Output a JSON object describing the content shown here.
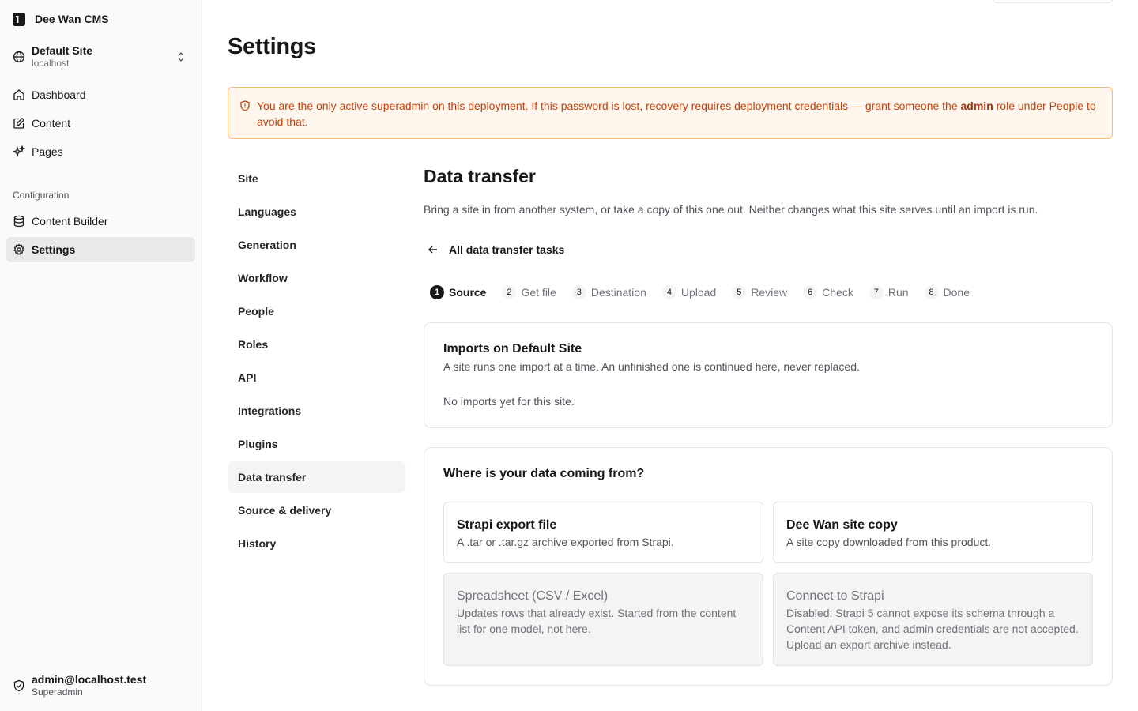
{
  "app": {
    "name": "Dee Wan CMS"
  },
  "site": {
    "name": "Default Site",
    "host": "localhost"
  },
  "nav": {
    "main": [
      {
        "label": "Dashboard",
        "icon": "home-icon"
      },
      {
        "label": "Content",
        "icon": "edit-icon"
      },
      {
        "label": "Pages",
        "icon": "sparkles-icon"
      }
    ],
    "group_label": "Configuration",
    "config": [
      {
        "label": "Content Builder",
        "icon": "database-icon"
      },
      {
        "label": "Settings",
        "icon": "gear-icon",
        "active": true
      }
    ]
  },
  "user": {
    "email": "admin@localhost.test",
    "role": "Superadmin"
  },
  "page": {
    "title": "Settings"
  },
  "alert": {
    "text_before": "You are the only active superadmin on this deployment. If this password is lost, recovery requires deployment credentials — grant someone the ",
    "strong": "admin",
    "text_after": " role under People to avoid that."
  },
  "settings_nav": [
    "Site",
    "Languages",
    "Generation",
    "Workflow",
    "People",
    "Roles",
    "API",
    "Integrations",
    "Plugins",
    "Data transfer",
    "Source & delivery",
    "History"
  ],
  "settings_nav_active": "Data transfer",
  "data_transfer": {
    "title": "Data transfer",
    "description": "Bring a site in from another system, or take a copy of this one out. Neither changes what this site serves until an import is run.",
    "back_label": "All data transfer tasks",
    "steps": [
      {
        "num": "1",
        "label": "Source",
        "current": true
      },
      {
        "num": "2",
        "label": "Get file"
      },
      {
        "num": "3",
        "label": "Destination"
      },
      {
        "num": "4",
        "label": "Upload"
      },
      {
        "num": "5",
        "label": "Review"
      },
      {
        "num": "6",
        "label": "Check"
      },
      {
        "num": "7",
        "label": "Run"
      },
      {
        "num": "8",
        "label": "Done"
      }
    ],
    "imports": {
      "title": "Imports on Default Site",
      "description": "A site runs one import at a time. An unfinished one is continued here, never replaced.",
      "empty": "No imports yet for this site."
    },
    "source": {
      "question": "Where is your data coming from?",
      "options": [
        {
          "title": "Strapi export file",
          "description": "A .tar or .tar.gz archive exported from Strapi.",
          "disabled": false
        },
        {
          "title": "Dee Wan site copy",
          "description": "A site copy downloaded from this product.",
          "disabled": false
        },
        {
          "title": "Spreadsheet (CSV / Excel)",
          "description": "Updates rows that already exist. Started from the content list for one model, not here.",
          "disabled": true
        },
        {
          "title": "Connect to Strapi",
          "description": "Disabled: Strapi 5 cannot expose its schema through a Content API token, and admin credentials are not accepted. Upload an export archive instead.",
          "disabled": true
        }
      ]
    }
  }
}
